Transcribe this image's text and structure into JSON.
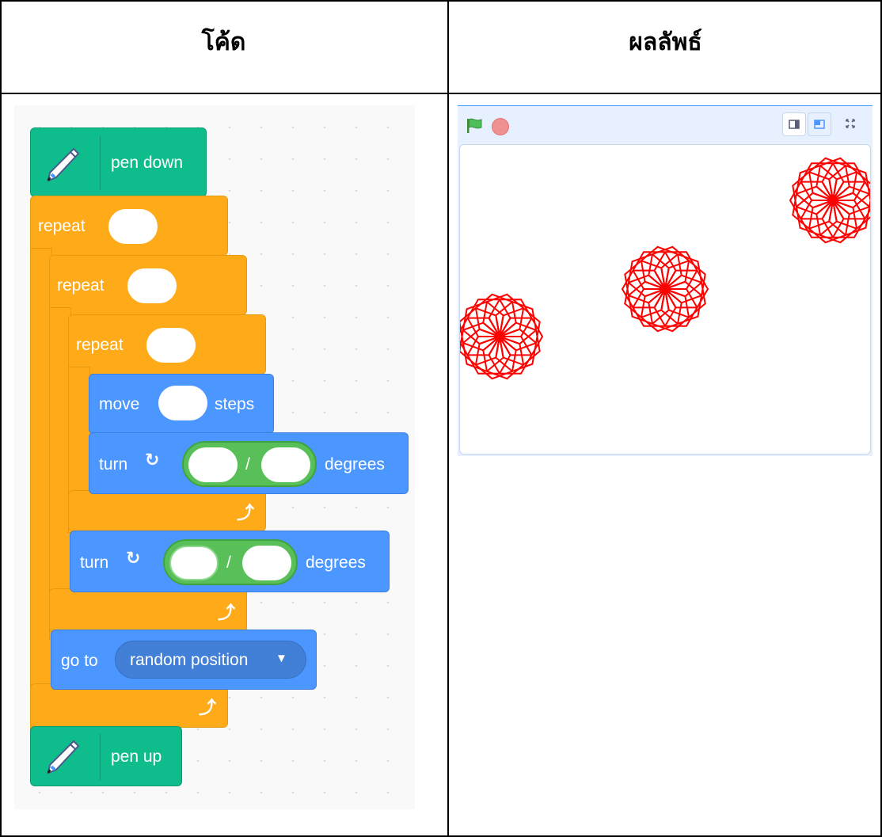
{
  "table": {
    "header_left": "โค้ด",
    "header_right": "ผลลัพธ์"
  },
  "code": {
    "pen_down": "pen down",
    "repeat1": "repeat",
    "repeat2": "repeat",
    "repeat3": "repeat",
    "move": "move",
    "steps": "steps",
    "turn1": "turn",
    "slash1": "/",
    "degrees1": "degrees",
    "turn2": "turn",
    "slash2": "/",
    "degrees2": "degrees",
    "go_to": "go to",
    "random_position": "random position",
    "pen_up": "pen up"
  },
  "colors": {
    "motion": "#4c97ff",
    "control": "#ffab19",
    "pen": "#0fbd8c",
    "operator": "#59c059",
    "drawing": "#ff0000"
  },
  "stage": {
    "icons": [
      "green-flag-icon",
      "stop-icon",
      "small-stage-icon",
      "large-stage-icon",
      "fullscreen-icon"
    ]
  }
}
